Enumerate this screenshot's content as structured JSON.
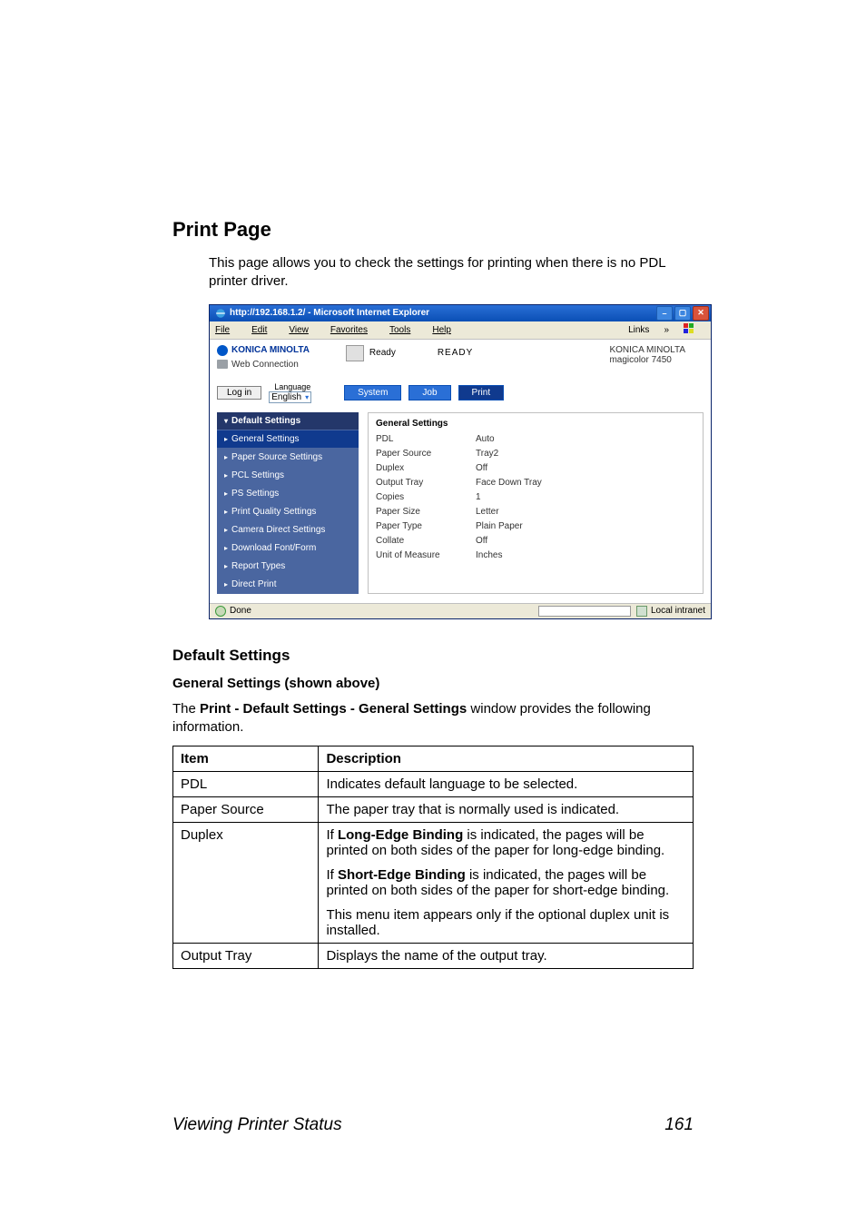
{
  "heading": "Print Page",
  "intro": "This page allows you to check the settings for printing when there is no PDL printer driver.",
  "screenshot": {
    "title": "http://192.168.1.2/ - Microsoft Internet Explorer",
    "menu": {
      "file": "File",
      "edit": "Edit",
      "view": "View",
      "favorites": "Favorites",
      "tools": "Tools",
      "help": "Help",
      "links": "Links"
    },
    "brand": "KONICA MINOLTA",
    "webconn": "Web Connection",
    "status_label": "Ready",
    "status_big": "READY",
    "right_brand": "KONICA MINOLTA",
    "right_model": "magicolor 7450",
    "login": "Log in",
    "language_label": "Language",
    "language_value": "English",
    "tabs": {
      "system": "System",
      "job": "Job",
      "print": "Print"
    },
    "sidebar": {
      "header": "Default Settings",
      "items": [
        "General Settings",
        "Paper Source Settings",
        "PCL Settings",
        "PS Settings",
        "Print Quality Settings",
        "Camera Direct Settings",
        "Download Font/Form",
        "Report Types",
        "Direct Print"
      ]
    },
    "panel": {
      "title": "General Settings",
      "rows": [
        {
          "k": "PDL",
          "v": "Auto"
        },
        {
          "k": "Paper Source",
          "v": "Tray2"
        },
        {
          "k": "Duplex",
          "v": "Off"
        },
        {
          "k": "Output Tray",
          "v": "Face Down Tray"
        },
        {
          "k": "Copies",
          "v": "1"
        },
        {
          "k": "Paper Size",
          "v": "Letter"
        },
        {
          "k": "Paper Type",
          "v": "Plain Paper"
        },
        {
          "k": "Collate",
          "v": "Off"
        },
        {
          "k": "Unit of Measure",
          "v": "Inches"
        }
      ]
    },
    "status_done": "Done",
    "status_zone": "Local intranet"
  },
  "section2": "Default Settings",
  "section3": "General Settings (shown above)",
  "desc_pre": "The ",
  "desc_bold": "Print - Default Settings - General Settings",
  "desc_post": " window provides the following information.",
  "table": {
    "h1": "Item",
    "h2": "Description",
    "r1_item": "PDL",
    "r1_desc": "Indicates default language to be selected.",
    "r2_item": "Paper Source",
    "r2_desc": "The paper tray that is normally used is indicated.",
    "r3_item": "Duplex",
    "r3_p1_pre": "If ",
    "r3_p1_bold": "Long-Edge Binding",
    "r3_p1_post": " is indicated, the pages will be printed on both sides of the paper for long-edge binding.",
    "r3_p2_pre": "If ",
    "r3_p2_bold": "Short-Edge Binding",
    "r3_p2_post": " is indicated, the pages will be printed on both sides of the paper for short-edge binding.",
    "r3_p3": "This menu item appears only if the optional duplex unit is installed.",
    "r4_item": "Output Tray",
    "r4_desc": "Displays the name of the output tray."
  },
  "footer_left": "Viewing Printer Status",
  "footer_right": "161"
}
